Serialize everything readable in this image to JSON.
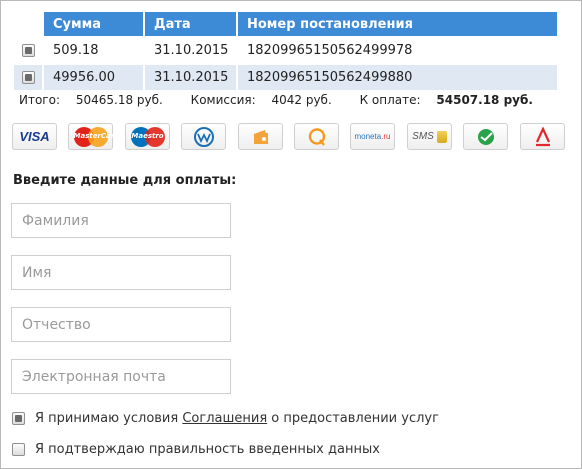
{
  "table": {
    "headers": [
      "Сумма",
      "Дата",
      "Номер постановления"
    ],
    "rows": [
      {
        "amount": "509.18",
        "date": "31.10.2015",
        "number": "18209965150562499978",
        "checked": true
      },
      {
        "amount": "49956.00",
        "date": "31.10.2015",
        "number": "18209965150562499880",
        "checked": true
      }
    ]
  },
  "summary": {
    "total_label": "Итого:",
    "total_value": "50465.18 руб.",
    "commission_label": "Комиссия:",
    "commission_value": "4042 руб.",
    "pay_label": "К оплате:",
    "pay_value": "54507.18 руб."
  },
  "payment_methods": [
    {
      "name": "VISA",
      "icon": "visa-icon"
    },
    {
      "name": "MasterCard",
      "icon": "mastercard-icon"
    },
    {
      "name": "Maestro",
      "icon": "maestro-icon"
    },
    {
      "name": "WebMoney",
      "icon": "webmoney-icon"
    },
    {
      "name": "Яндекс.Деньги",
      "icon": "yandex-money-icon"
    },
    {
      "name": "QIWI",
      "icon": "qiwi-icon"
    },
    {
      "name": "moneta.ru",
      "icon": "moneta-icon"
    },
    {
      "name": "SMS",
      "icon": "sms-icon"
    },
    {
      "name": "Сбербанк",
      "icon": "sberbank-icon"
    },
    {
      "name": "Альфа-Банк",
      "icon": "alfa-bank-icon"
    }
  ],
  "form": {
    "title": "Введите данные для оплаты:",
    "surname_placeholder": "Фамилия",
    "name_placeholder": "Имя",
    "patronymic_placeholder": "Отчество",
    "email_placeholder": "Электронная почта",
    "agree_terms_prefix": "Я принимаю условия",
    "agree_terms_link": "Соглашения",
    "agree_terms_suffix": "о предоставлении услуг",
    "agree_terms_checked": true,
    "confirm_data_label": "Я подтверждаю правильность введенных данных",
    "confirm_data_checked": false
  },
  "colors": {
    "header_bg": "#3d8ad6",
    "row_alt_bg": "#dfe8f3"
  }
}
